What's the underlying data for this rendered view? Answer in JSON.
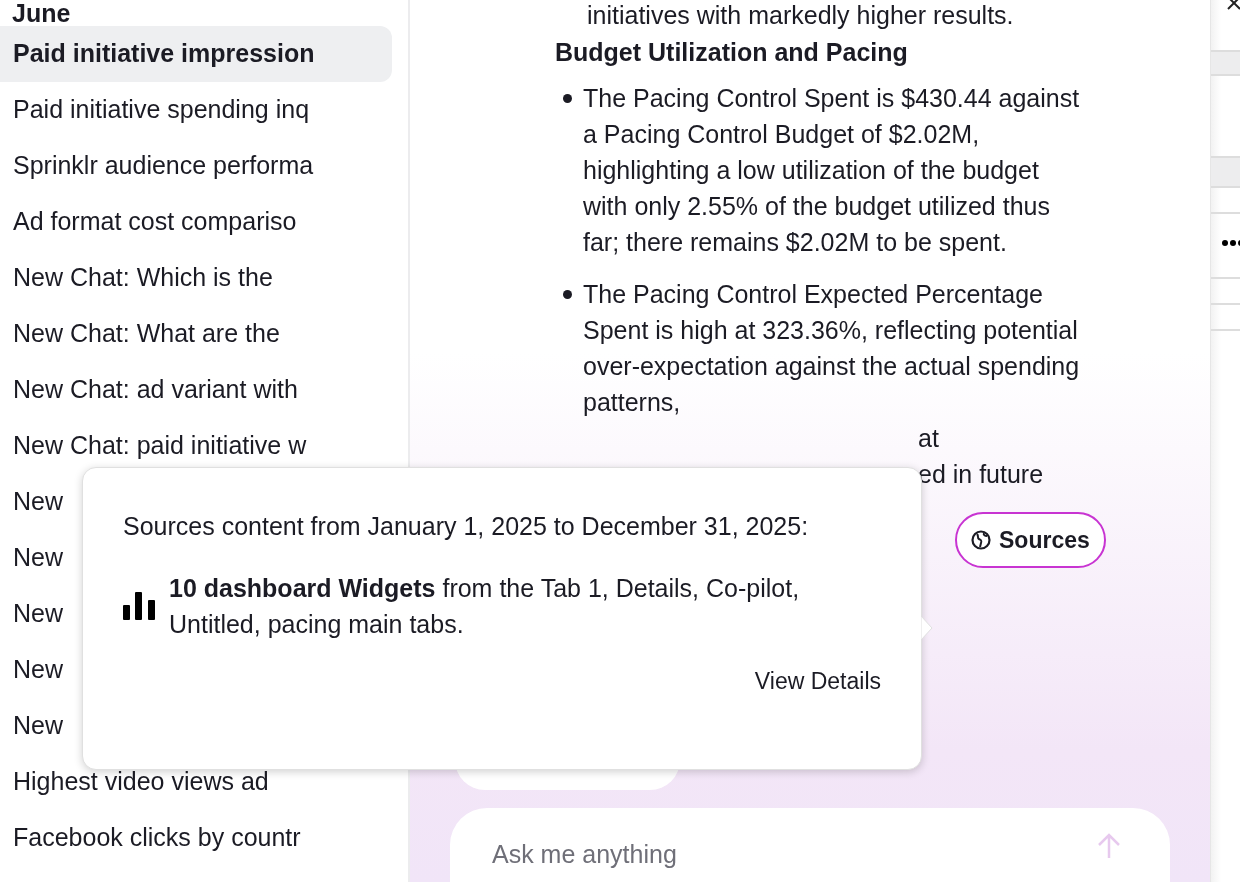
{
  "sidebar": {
    "group_label": "June",
    "items": [
      {
        "label": "Paid initiative impression",
        "selected": true
      },
      {
        "label": "Paid initiative spending inq",
        "selected": false
      },
      {
        "label": "Sprinklr audience performa",
        "selected": false
      },
      {
        "label": "Ad format cost compariso",
        "selected": false
      },
      {
        "label": "New Chat: Which is the",
        "selected": false
      },
      {
        "label": "New Chat: What are the",
        "selected": false
      },
      {
        "label": "New Chat: ad variant with",
        "selected": false
      },
      {
        "label": "New Chat: paid initiative w",
        "selected": false
      },
      {
        "label": "New",
        "selected": false
      },
      {
        "label": "New",
        "selected": false
      },
      {
        "label": "New",
        "selected": false
      },
      {
        "label": "New",
        "selected": false
      },
      {
        "label": "New",
        "selected": false
      },
      {
        "label": "Highest video views ad",
        "selected": false
      },
      {
        "label": "Facebook clicks by countr",
        "selected": false
      }
    ]
  },
  "message": {
    "intro": "initiatives with markedly higher results.",
    "heading": "Budget Utilization and Pacing",
    "bullets": [
      {
        "text": "The Pacing Control Spent is $430.44 against a Pacing Control Budget of $2.02M, highlighting a low utilization of the budget with only 2.55% of the budget utilized thus far; there remains $2.02M to be spent."
      },
      {
        "text": "The Pacing Control Expected Percentage Spent is high at 323.36%, reflecting potential over-expectation against the actual spending patterns,",
        "fragments": [
          "at",
          "ed in future"
        ]
      }
    ]
  },
  "sources_button": {
    "label": "Sources"
  },
  "popover": {
    "date_text": "Sources content from January 1, 2025 to December 31, 2025:",
    "source": "**10 dashboard Widgets** from the Tab 1, Details, Co-pilot, Untitled, pacing main tabs.",
    "link": "View Details"
  },
  "composer": {
    "placeholder": "Ask me anything"
  }
}
